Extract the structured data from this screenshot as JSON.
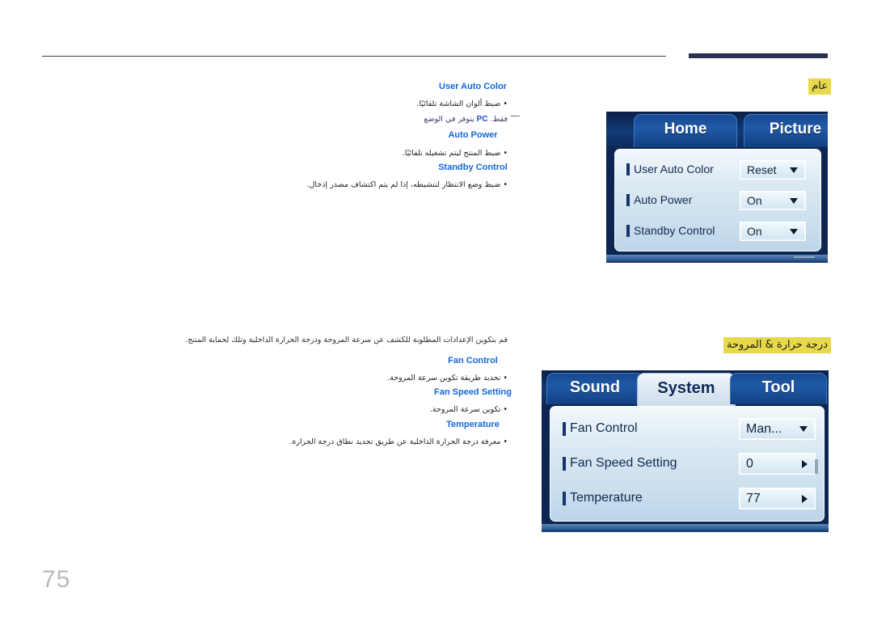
{
  "page": {
    "number": "75"
  },
  "sections": [
    {
      "id": "general",
      "heading": "عام",
      "items": [
        {
          "title": "User Auto Color",
          "bullet": "ضبط ألوان الشاشة تلقائيًا.",
          "note_prefix": "يتوفر في الوضع",
          "note_token": "PC",
          "note_suffix": "فقط."
        },
        {
          "title": "Auto Power",
          "bullet": "ضبط المنتج ليتم تشغيله تلقائيًا."
        },
        {
          "title": "Standby Control",
          "bullet": "ضبط وضع الانتظار لتنشيطه، إذا لم يتم اكتشاف مصدر إدخال."
        }
      ]
    },
    {
      "id": "temperature-fan",
      "heading": "درجة حرارة & المروحة",
      "intro": "قم بتكوين الإعدادات المطلوبة للكشف عن سرعة المروحة ودرجة الحرارة الداخلية وتلك لحماية المنتج.",
      "items": [
        {
          "title": "Fan Control",
          "bullet": "تحديد طريقة تكوين سرعة المروحة."
        },
        {
          "title": "Fan Speed Setting",
          "bullet": "تكوين سرعة المروحة."
        },
        {
          "title": "Temperature",
          "bullet": "معرفة درجة الحرارة الداخلية عن طريق تحديد نطاق درجة الحرارة."
        }
      ]
    }
  ],
  "osd_general": {
    "tabs": [
      {
        "label": "Home",
        "active": false
      },
      {
        "label": "Picture",
        "active": false
      },
      {
        "label": "",
        "active": false
      }
    ],
    "rows": [
      {
        "label": "User Auto Color",
        "value": "Reset",
        "control": "dropdown"
      },
      {
        "label": "Auto Power",
        "value": "On",
        "control": "dropdown"
      },
      {
        "label": "Standby Control",
        "value": "On",
        "control": "dropdown"
      }
    ]
  },
  "osd_system": {
    "tabs": [
      {
        "label": "Sound",
        "active": false
      },
      {
        "label": "System",
        "active": true
      },
      {
        "label": "Tool",
        "active": false
      }
    ],
    "rows": [
      {
        "label": "Fan Control",
        "value": "Man...",
        "control": "dropdown"
      },
      {
        "label": "Fan Speed Setting",
        "value": "0",
        "control": "stepper"
      },
      {
        "label": "Temperature",
        "value": "77",
        "control": "stepper"
      }
    ]
  },
  "colors": {
    "highlight": "#e8d94a",
    "heading_blue": "#1468d8",
    "rule_dark": "#2b3050",
    "page_number": "#b9b9bd"
  }
}
